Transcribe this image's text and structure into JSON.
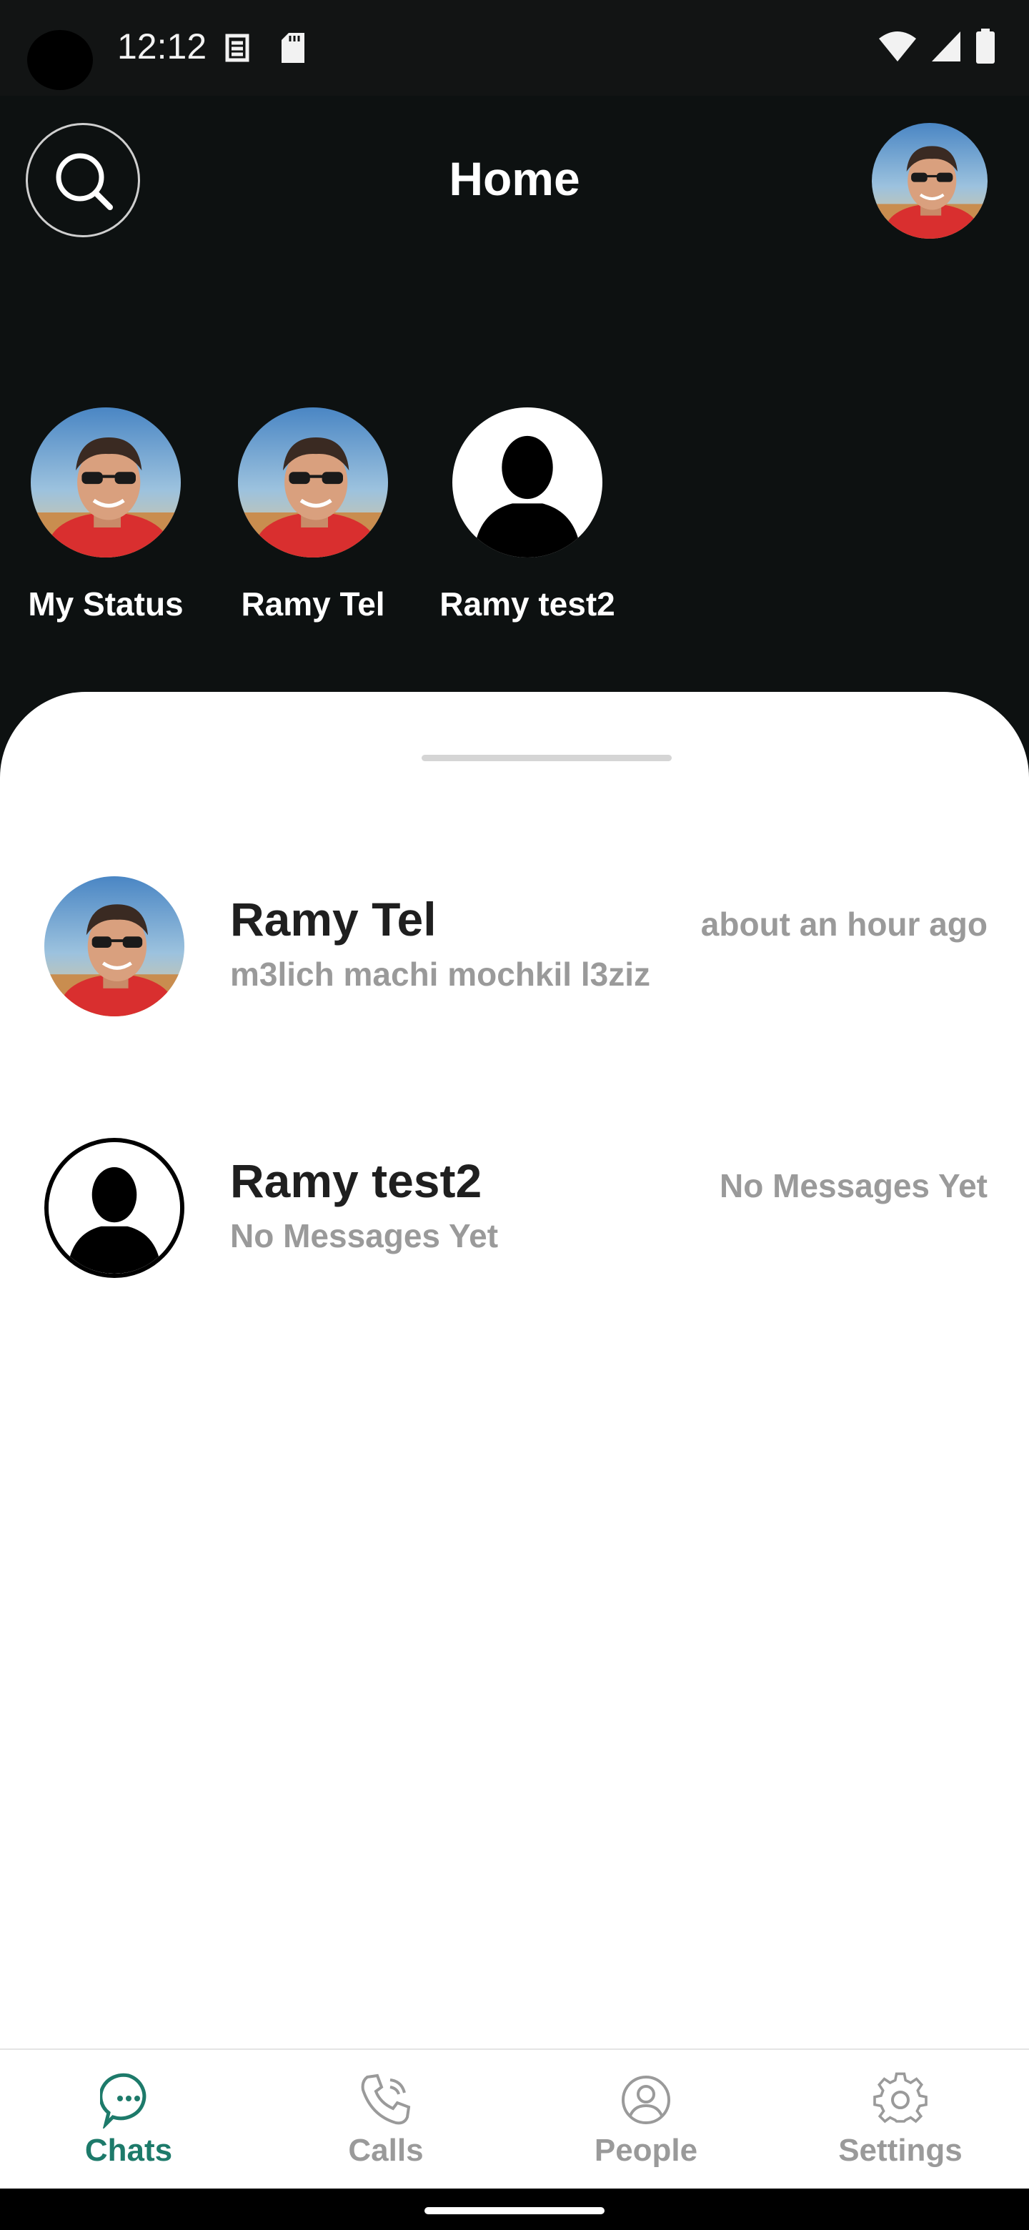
{
  "status_bar": {
    "time": "12:12",
    "icons": [
      "sim-icon",
      "sd-card-icon",
      "wifi-icon",
      "signal-icon",
      "battery-icon"
    ]
  },
  "header": {
    "title": "Home",
    "search_icon": "search-icon"
  },
  "statuses": [
    {
      "label": "My Status",
      "avatar": "photo"
    },
    {
      "label": "Ramy Tel",
      "avatar": "photo"
    },
    {
      "label": "Ramy test2",
      "avatar": "silhouette"
    }
  ],
  "chats": [
    {
      "name": "Ramy Tel",
      "preview": "m3lich machi mochkil l3ziz",
      "time": "about an hour ago",
      "avatar": "photo"
    },
    {
      "name": "Ramy test2",
      "preview": "No Messages Yet",
      "time": "No Messages Yet",
      "avatar": "silhouette"
    }
  ],
  "nav": {
    "items": [
      {
        "label": "Chats",
        "icon": "chat-bubble-icon",
        "active": true
      },
      {
        "label": "Calls",
        "icon": "phone-icon",
        "active": false
      },
      {
        "label": "People",
        "icon": "person-icon",
        "active": false
      },
      {
        "label": "Settings",
        "icon": "gear-icon",
        "active": false
      }
    ]
  },
  "colors": {
    "header_bg": "#0d1111",
    "accent": "#1d7a6a",
    "muted": "#9a9a9a"
  }
}
